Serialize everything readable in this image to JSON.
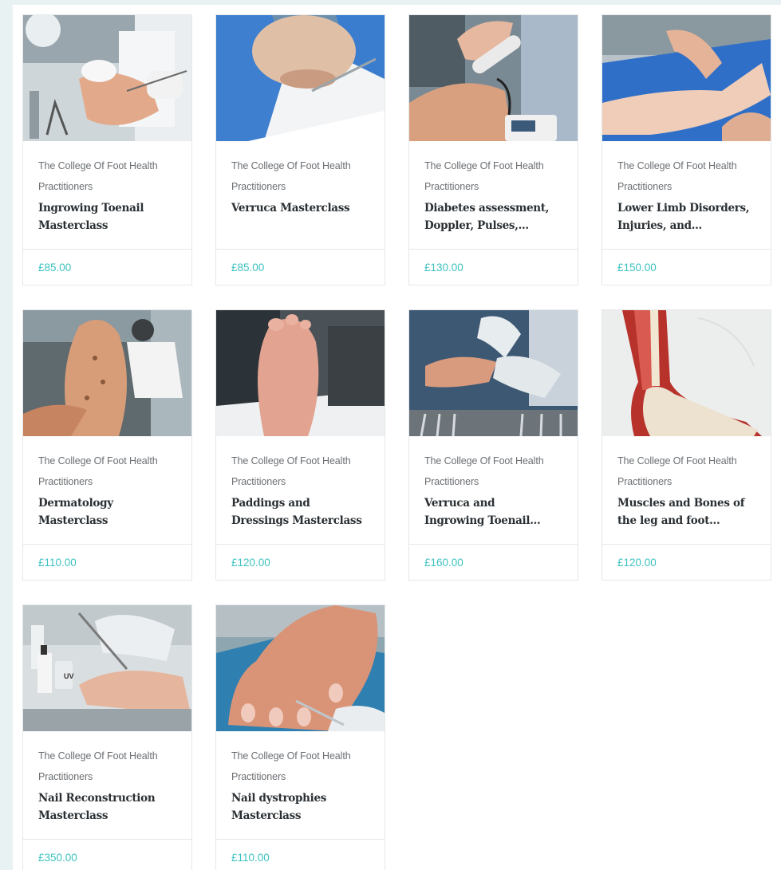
{
  "products": [
    {
      "vendor_line1": "The College Of Foot Health",
      "vendor_line2": "Practitioners",
      "title_line1": "Ingrowing Toenail",
      "title_line2": "Masterclass",
      "price": "£85.00",
      "image": "toenail-clipping-photo"
    },
    {
      "vendor_line1": "The College Of Foot Health",
      "vendor_line2": "Practitioners",
      "title_line1": "Verruca Masterclass",
      "title_line2": "",
      "price": "£85.00",
      "image": "verruca-treatment-photo"
    },
    {
      "vendor_line1": "The College Of Foot Health",
      "vendor_line2": "Practitioners",
      "title_line1": "Diabetes assessment,",
      "title_line2": "Doppler, Pulses,...",
      "price": "£130.00",
      "image": "doppler-probe-photo"
    },
    {
      "vendor_line1": "The College Of Foot Health",
      "vendor_line2": "Practitioners",
      "title_line1": "Lower Limb Disorders,",
      "title_line2": "Injuries, and...",
      "price": "£150.00",
      "image": "leg-examination-photo"
    },
    {
      "vendor_line1": "The College Of Foot Health",
      "vendor_line2": "Practitioners",
      "title_line1": "Dermatology",
      "title_line2": "Masterclass",
      "price": "£110.00",
      "image": "skin-inspection-photo"
    },
    {
      "vendor_line1": "The College Of Foot Health",
      "vendor_line2": "Practitioners",
      "title_line1": "Paddings and",
      "title_line2": "Dressings Masterclass",
      "price": "£120.00",
      "image": "foot-sole-photo"
    },
    {
      "vendor_line1": "The College Of Foot Health",
      "vendor_line2": "Practitioners",
      "title_line1": "Verruca and",
      "title_line2": "Ingrowing Toenail...",
      "price": "£160.00",
      "image": "surgical-tools-photo"
    },
    {
      "vendor_line1": "The College Of Foot Health",
      "vendor_line2": "Practitioners",
      "title_line1": "Muscles and Bones of",
      "title_line2": "the leg and foot...",
      "price": "£120.00",
      "image": "anatomy-illustration"
    },
    {
      "vendor_line1": "The College Of Foot Health",
      "vendor_line2": "Practitioners",
      "title_line1": "Nail Reconstruction",
      "title_line2": "Masterclass",
      "price": "£350.00",
      "image": "nail-reconstruction-photo",
      "badge": "UV"
    },
    {
      "vendor_line1": "The College Of Foot Health",
      "vendor_line2": "Practitioners",
      "title_line1": "Nail dystrophies",
      "title_line2": "Masterclass",
      "price": "£110.00",
      "image": "hand-nails-photo"
    }
  ],
  "colors": {
    "price": "#3cc2c0",
    "page_background": "#e8f2f3",
    "card_border": "#e4e7ea"
  }
}
